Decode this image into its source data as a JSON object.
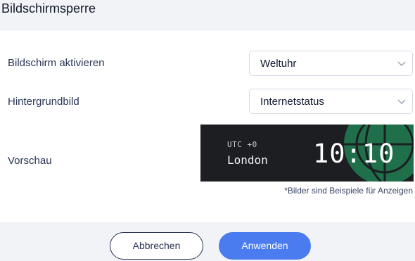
{
  "dialog": {
    "title": "Bildschirmsperre"
  },
  "settings": {
    "screen_label": "Bildschirm aktivieren",
    "screen_value": "Weltuhr",
    "wallpaper_label": "Hintergrundbild",
    "wallpaper_value": "Internetstatus",
    "preview_label": "Vorschau"
  },
  "preview": {
    "timezone": "UTC +0",
    "city": "London",
    "time": "10:10",
    "accent_color": "#1f6f4a"
  },
  "note": "*Bilder sind Beispiele für Anzeigen",
  "buttons": {
    "cancel": "Abbrechen",
    "apply": "Anwenden"
  },
  "colors": {
    "primary": "#4a7cf0",
    "text": "#2a3556",
    "panel": "#f2f3f7"
  }
}
